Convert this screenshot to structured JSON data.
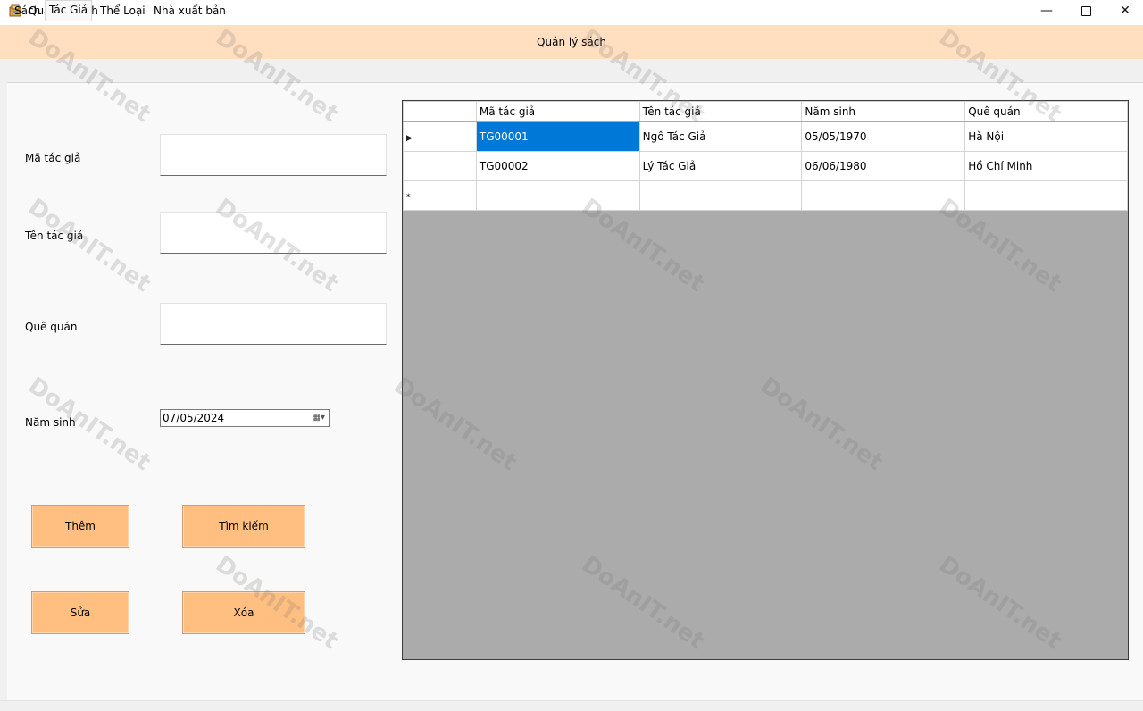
{
  "window": {
    "title": "Quản lý sách",
    "minimize_glyph": "—",
    "close_glyph": "✕"
  },
  "header": {
    "title": "Quản lý sách"
  },
  "tabs": [
    {
      "label": "Sách"
    },
    {
      "label": "Tác Giả",
      "active": true
    },
    {
      "label": "Thể Loại"
    },
    {
      "label": "Nhà xuất bản"
    }
  ],
  "form": {
    "ma_tac_gia_label": "Mã tác giả",
    "ma_tac_gia_value": "",
    "ten_tac_gia_label": "Tên tác giả",
    "ten_tac_gia_value": "",
    "que_quan_label": "Quê quán",
    "que_quan_value": "",
    "nam_sinh_label": "Năm sinh",
    "nam_sinh_value": "07/05/2024",
    "calendar_glyph": "▦▾"
  },
  "buttons": {
    "add": "Thêm",
    "search": "Tìm kiếm",
    "edit": "Sửa",
    "delete": "Xóa"
  },
  "colors": {
    "header_band": "#ffdfbf",
    "button": "#ffbf80",
    "selection": "#0078d7",
    "grid_background": "#ababab"
  },
  "table": {
    "columns": [
      "Mã tác giả",
      "Tên tác giả",
      "Năm sinh",
      "Quê quán"
    ],
    "rows": [
      {
        "marker": "▶",
        "cells": [
          "TG00001",
          "Ngô Tác Giả",
          "05/05/1970",
          "Hà Nội"
        ]
      },
      {
        "marker": "",
        "cells": [
          "TG00002",
          "Lý Tác Giả",
          "06/06/1980",
          "Hồ Chí Minh"
        ]
      },
      {
        "marker": "*",
        "cells": [
          "",
          "",
          "",
          ""
        ]
      }
    ]
  },
  "watermark": {
    "text": "DoAnIT.net"
  }
}
